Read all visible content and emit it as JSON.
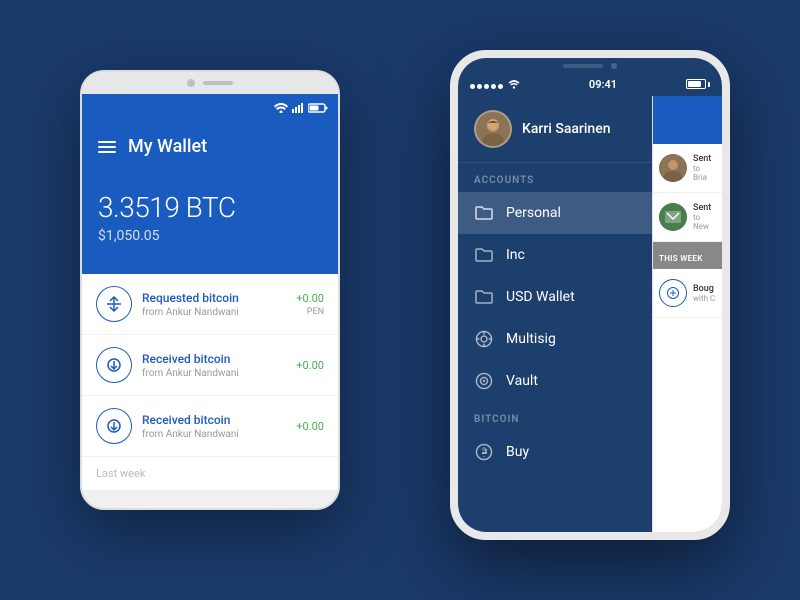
{
  "background_color": "#1a3a6b",
  "android_phone": {
    "header_title": "My Wallet",
    "btc_amount": "3.3519 BTC",
    "usd_amount": "$1,050.05",
    "transactions": [
      {
        "type": "request",
        "title": "Requested bitcoin",
        "subtitle": "from Ankur Nandwani",
        "amount": "+0.00",
        "status": "PEN"
      },
      {
        "type": "receive",
        "title": "Received bitcoin",
        "subtitle": "from Ankur Nandwani",
        "amount": "+0.00",
        "status": ""
      },
      {
        "type": "receive",
        "title": "Received bitcoin",
        "subtitle": "from Ankur Nandwani",
        "amount": "+0.00",
        "status": ""
      }
    ],
    "last_week_label": "Last week"
  },
  "iphone": {
    "status_time": "09:41",
    "user_name": "Karri Saarinen",
    "sections": [
      {
        "label": "ACCOUNTS",
        "items": [
          {
            "icon": "folder",
            "label": "Personal",
            "active": true
          },
          {
            "icon": "folder",
            "label": "Inc",
            "active": false
          },
          {
            "icon": "folder",
            "label": "USD Wallet",
            "active": false
          },
          {
            "icon": "multisig",
            "label": "Multisig",
            "active": false
          },
          {
            "icon": "vault",
            "label": "Vault",
            "active": false
          }
        ]
      },
      {
        "label": "BITCOIN",
        "items": [
          {
            "icon": "bitcoin",
            "label": "Buy",
            "active": false
          }
        ]
      }
    ],
    "peek": {
      "items": [
        {
          "title": "Sent",
          "sub": "to Bria",
          "color": "#8B6914"
        },
        {
          "title": "Sent",
          "sub": "to New",
          "color": "#4a7c4e"
        }
      ],
      "week_label": "THIS WEEK",
      "bottom_title": "Boug",
      "bottom_sub": "with C"
    }
  }
}
